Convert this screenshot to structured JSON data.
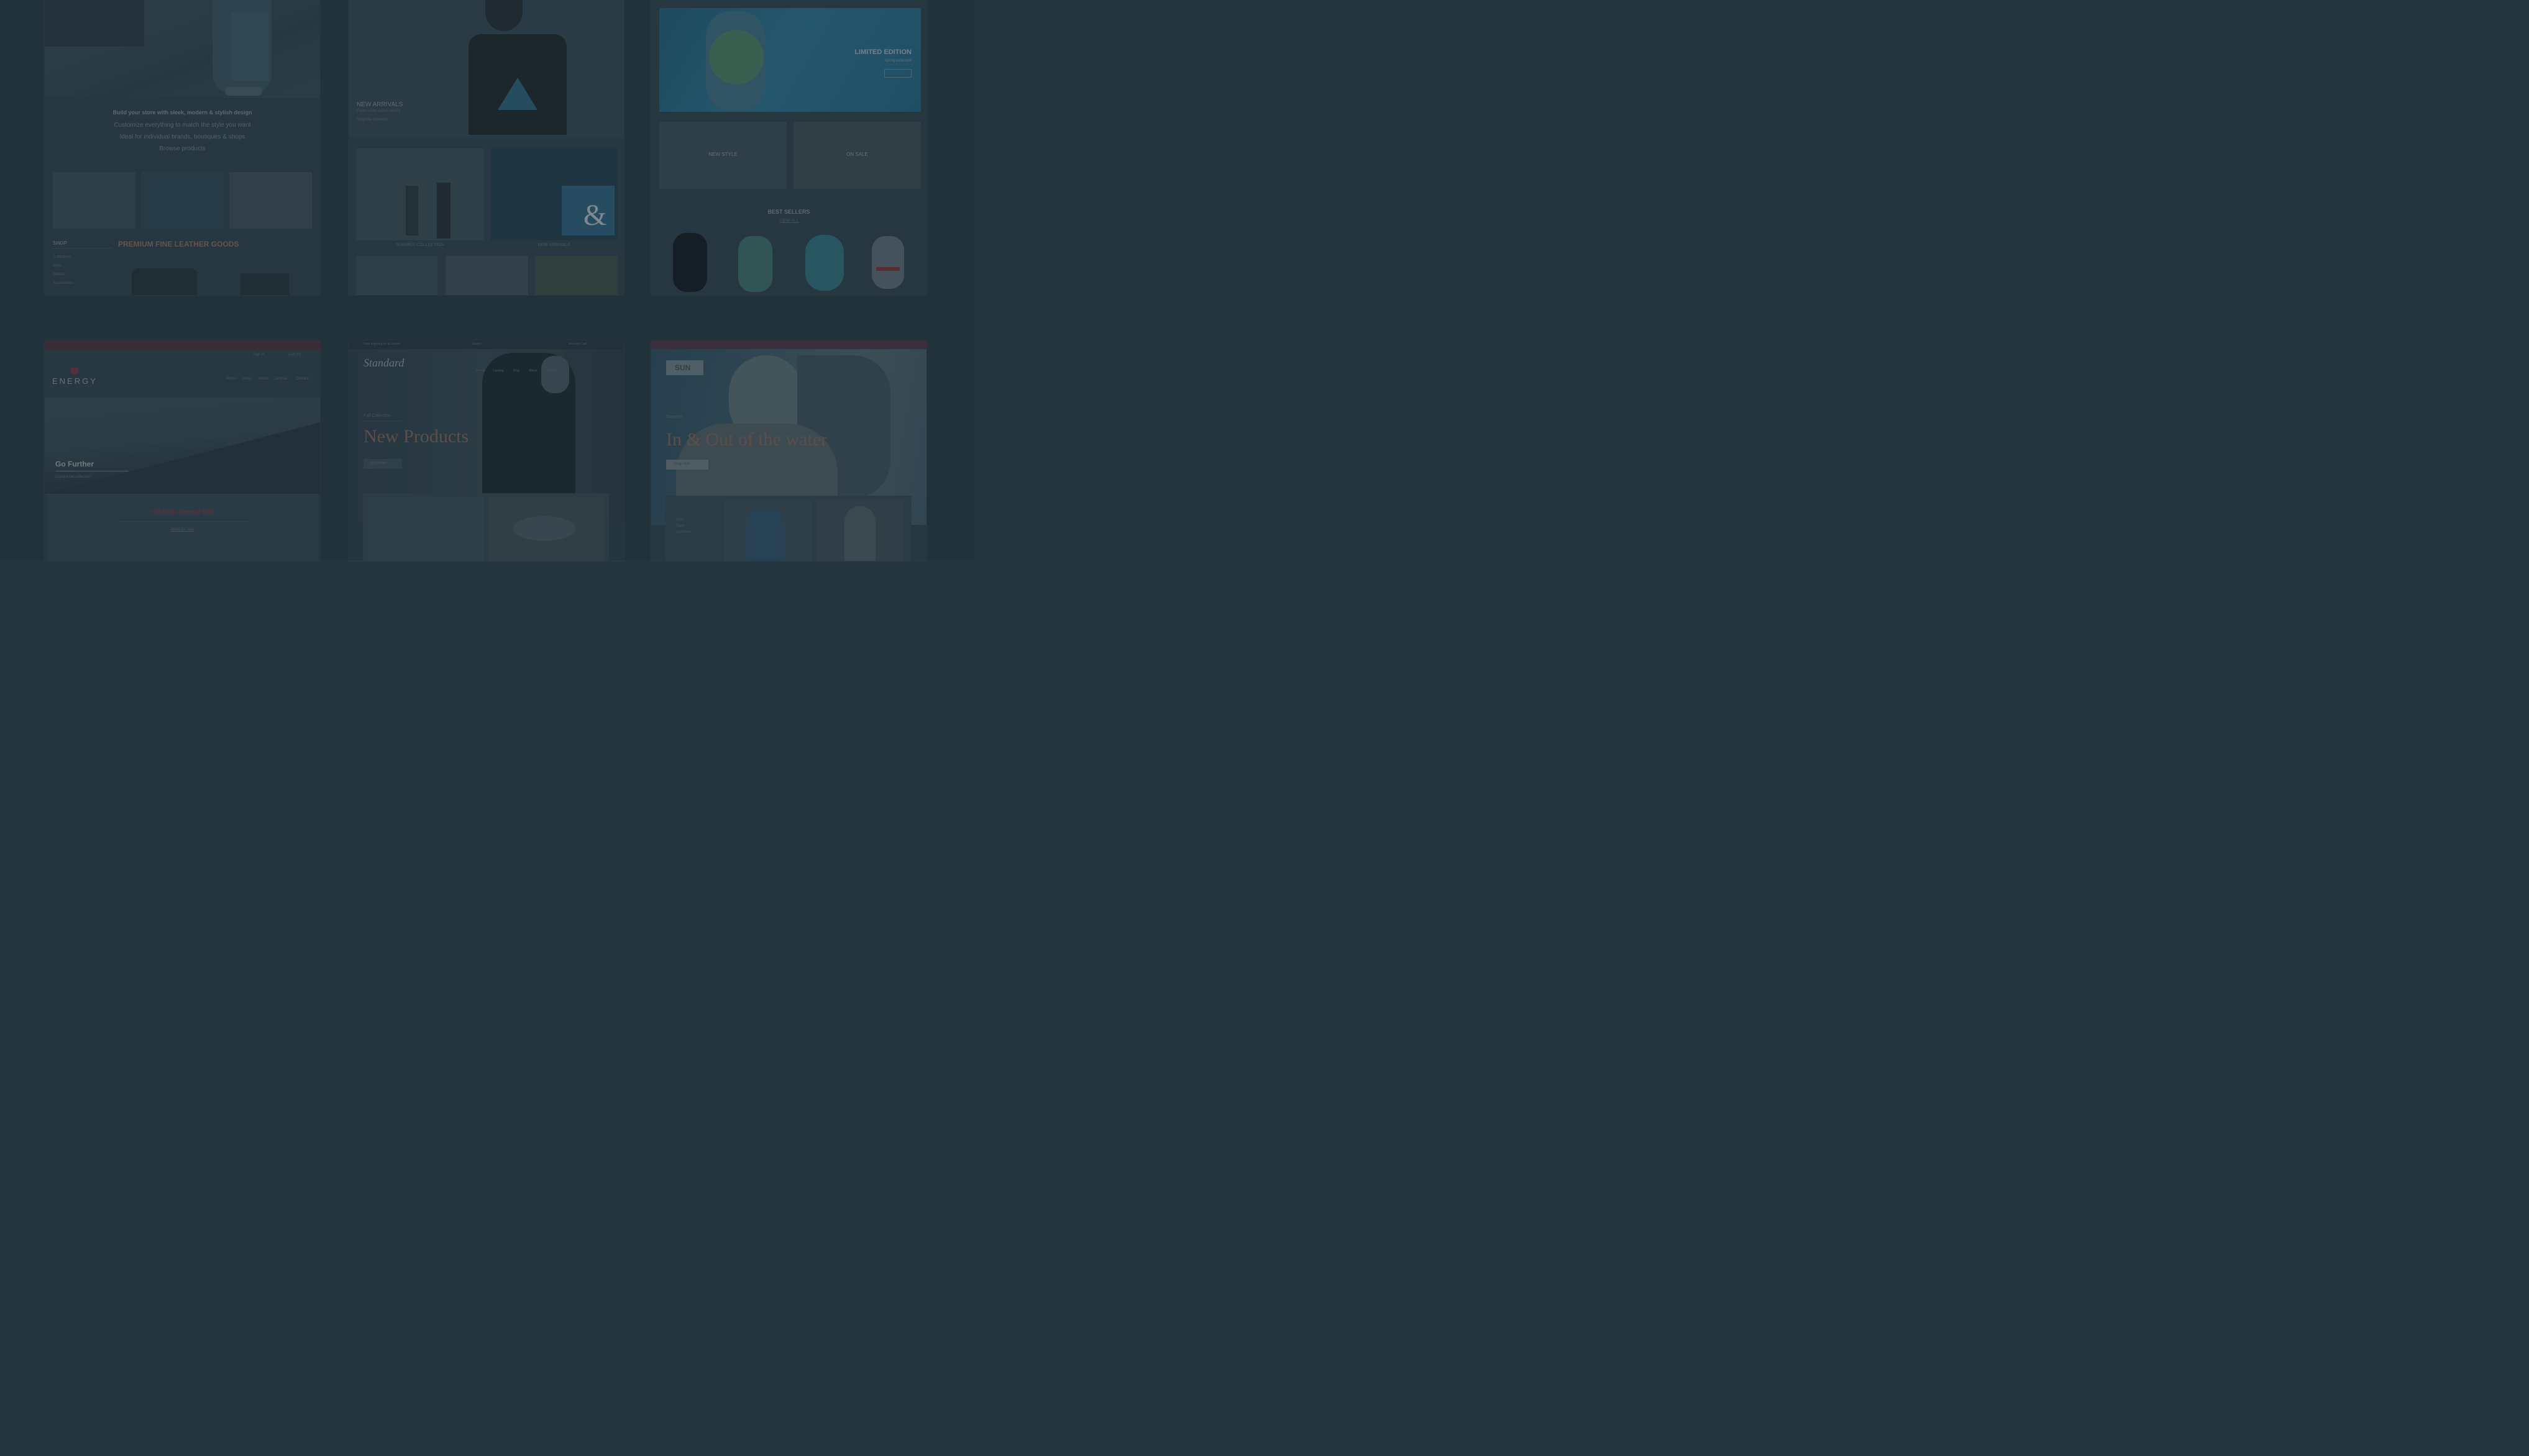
{
  "themes": {
    "leather": {
      "tagline_1": "Build your store with sleek, modern & stylish design",
      "tagline_2": "Customize everything to match the style you want",
      "tagline_3": "Ideal for individual brands, boutiques & shops",
      "tagline_4": "Browse products",
      "section_title": "PREMIUM FINE LEATHER GOODS",
      "sidebar_title": "SHOP",
      "sidebar_items": [
        "Collections",
        "Bags",
        "Wallets",
        "Accessories"
      ]
    },
    "tshirt": {
      "hero_title": "NEW ARRIVALS",
      "hero_sub": "Fresh styles added weekly",
      "hero_link": "Shop the collection",
      "caption_left": "SUMMER COLLECTION",
      "caption_right": "NEW ARRIVALS"
    },
    "watch": {
      "hero_title": "LIMITED EDITION",
      "hero_sub": "Spring collection",
      "hero_btn": "SHOP NOW",
      "banner_1": "NEW STYLE",
      "banner_2": "ON SALE",
      "best_title": "BEST SELLERS",
      "best_link": "VIEW ALL"
    },
    "energy": {
      "logo": "ENERGY",
      "nav": [
        "Home",
        "Shop",
        "About",
        "Journal",
        "Contact"
      ],
      "top_right": "Sign in",
      "cart": "Cart (0)",
      "hero_title": "Go Further",
      "hero_sub": "Explore the collection",
      "promo_title": "Hot Picks Summer Run",
      "promo_link": "Shop the sale"
    },
    "standard": {
      "logo": "Standard",
      "top_left": "Free shipping on all orders",
      "top_mid": "Search",
      "top_right": "Account  Cart",
      "nav": [
        "Home",
        "Catalog",
        "Blog",
        "About",
        "Contact"
      ],
      "kicker": "Fall Collection",
      "hero_title": "New Products",
      "hero_btn": "Shop now"
    },
    "beach": {
      "logo": "SUN",
      "kicker": "Summer",
      "hero_title": "In & Out of the water",
      "hero_btn": "Shop now",
      "card_text_1": "New",
      "card_text_2": "Swim",
      "card_text_3": "Collection"
    }
  },
  "colors": {
    "background": "#263640",
    "card": "#2c3d48",
    "accent_blue": "#2a6e8c",
    "accent_red": "#8e4352",
    "energy_red": "#7a2f3d"
  }
}
